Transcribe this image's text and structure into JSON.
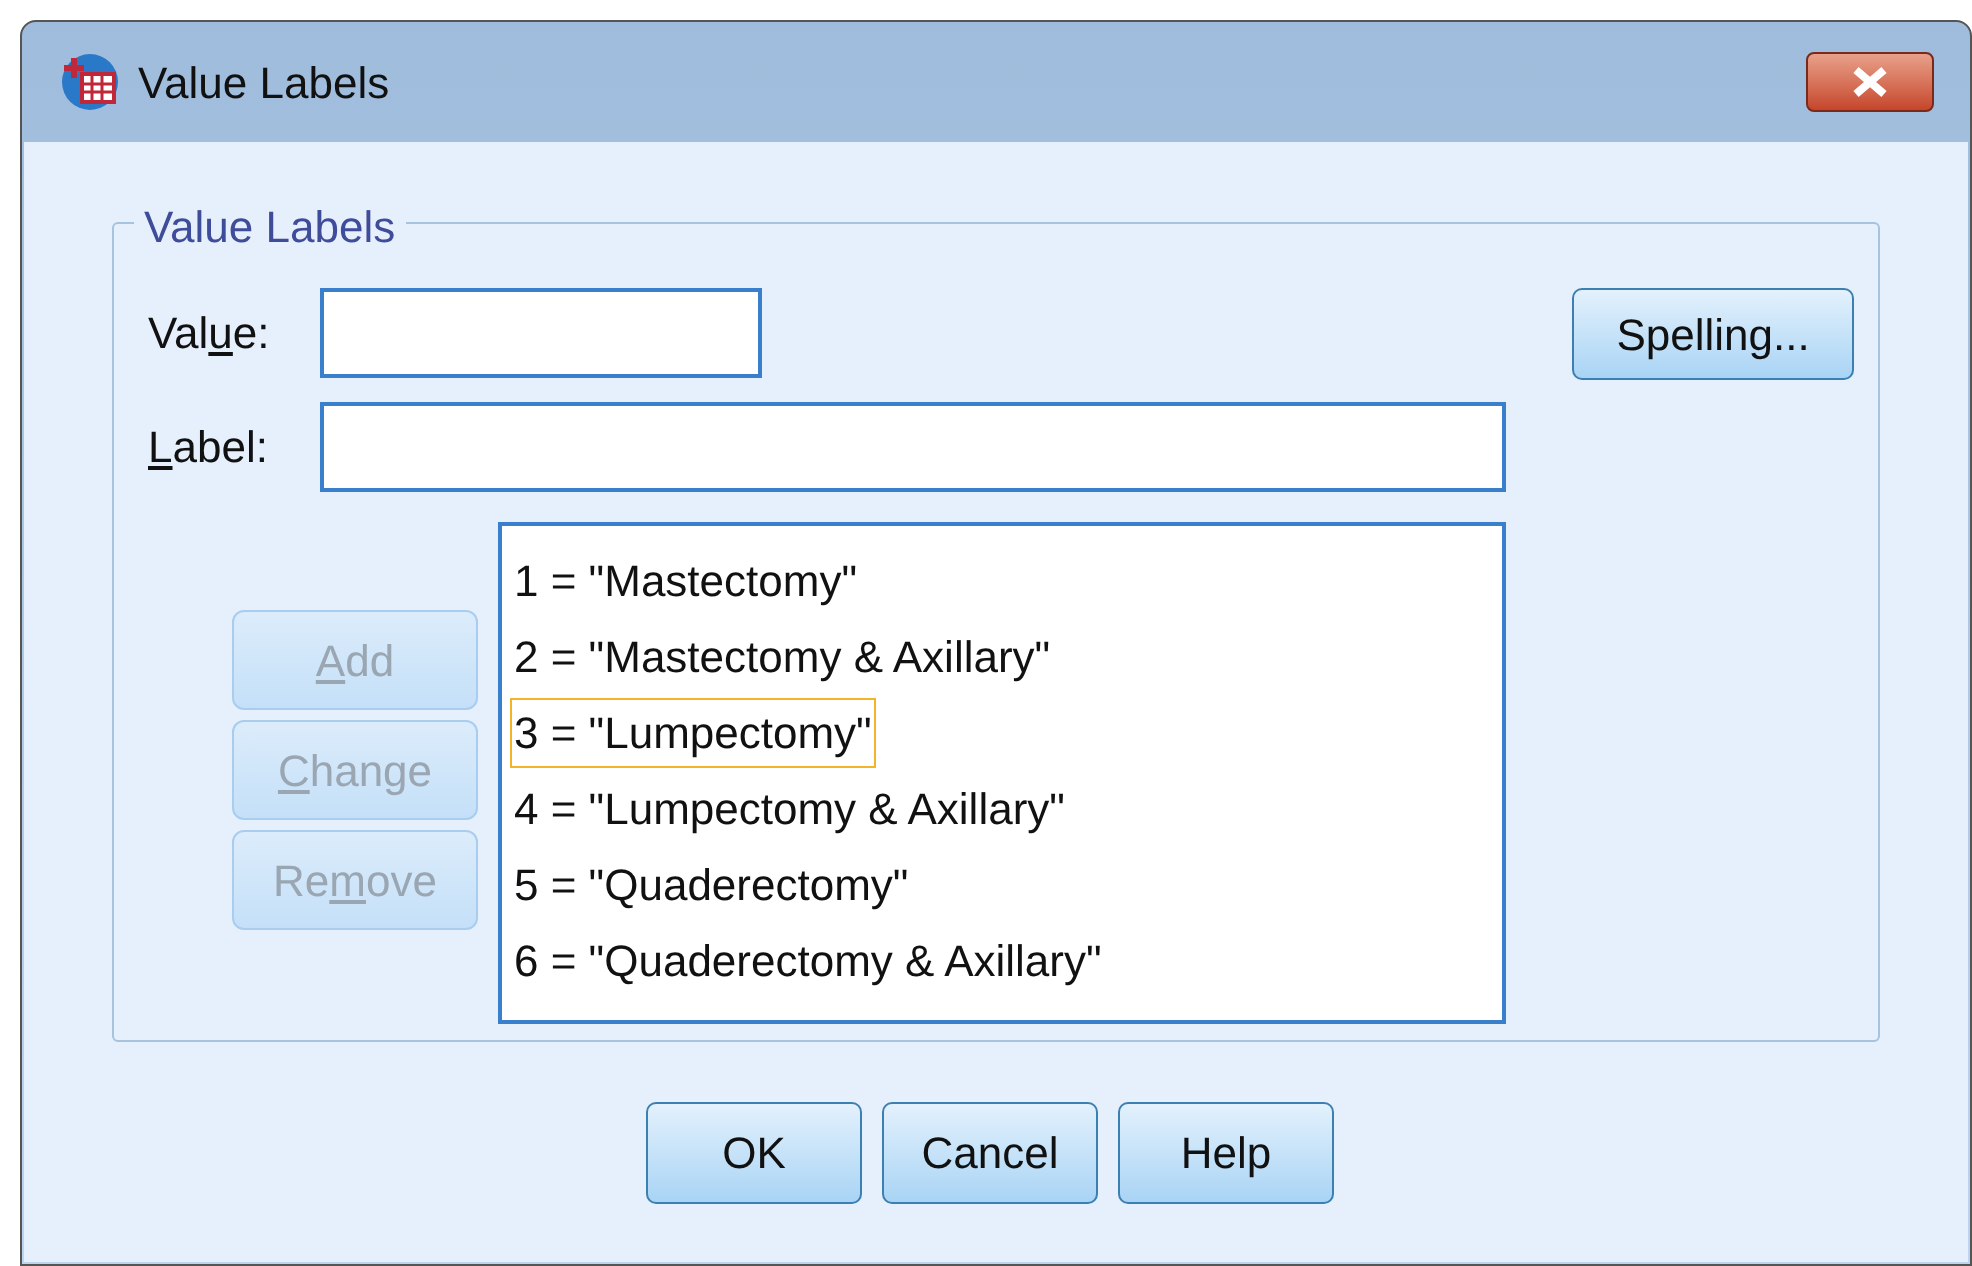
{
  "window": {
    "title": "Value Labels"
  },
  "group": {
    "title": "Value Labels"
  },
  "fields": [
    {
      "label_parts": {
        "before": "Val",
        "key": "u",
        "after": "e:"
      }
    },
    {
      "label_parts": {
        "key": "L",
        "after": "abel:"
      }
    }
  ],
  "spelling_button": {
    "label": "Spelling..."
  },
  "side_buttons": [
    {
      "label_parts": {
        "key": "A",
        "after": "dd"
      },
      "disabled": true
    },
    {
      "label_parts": {
        "key": "C",
        "after": "hange"
      },
      "disabled": true
    },
    {
      "label_parts": {
        "before": "Re",
        "key": "m",
        "after": "ove"
      },
      "disabled": true
    }
  ],
  "list": [
    {
      "text": "1 = \"Mastectomy\"",
      "selected": false
    },
    {
      "text": "2 = \"Mastectomy & Axillary\"",
      "selected": false
    },
    {
      "text": "3 = \"Lumpectomy\"",
      "selected": true
    },
    {
      "text": "4 = \"Lumpectomy & Axillary\"",
      "selected": false
    },
    {
      "text": "5 = \"Quaderectomy\"",
      "selected": false
    },
    {
      "text": "6 = \"Quaderectomy & Axillary\"",
      "selected": false
    }
  ],
  "buttons": [
    {
      "label": "OK"
    },
    {
      "label": "Cancel"
    },
    {
      "label": "Help"
    }
  ]
}
